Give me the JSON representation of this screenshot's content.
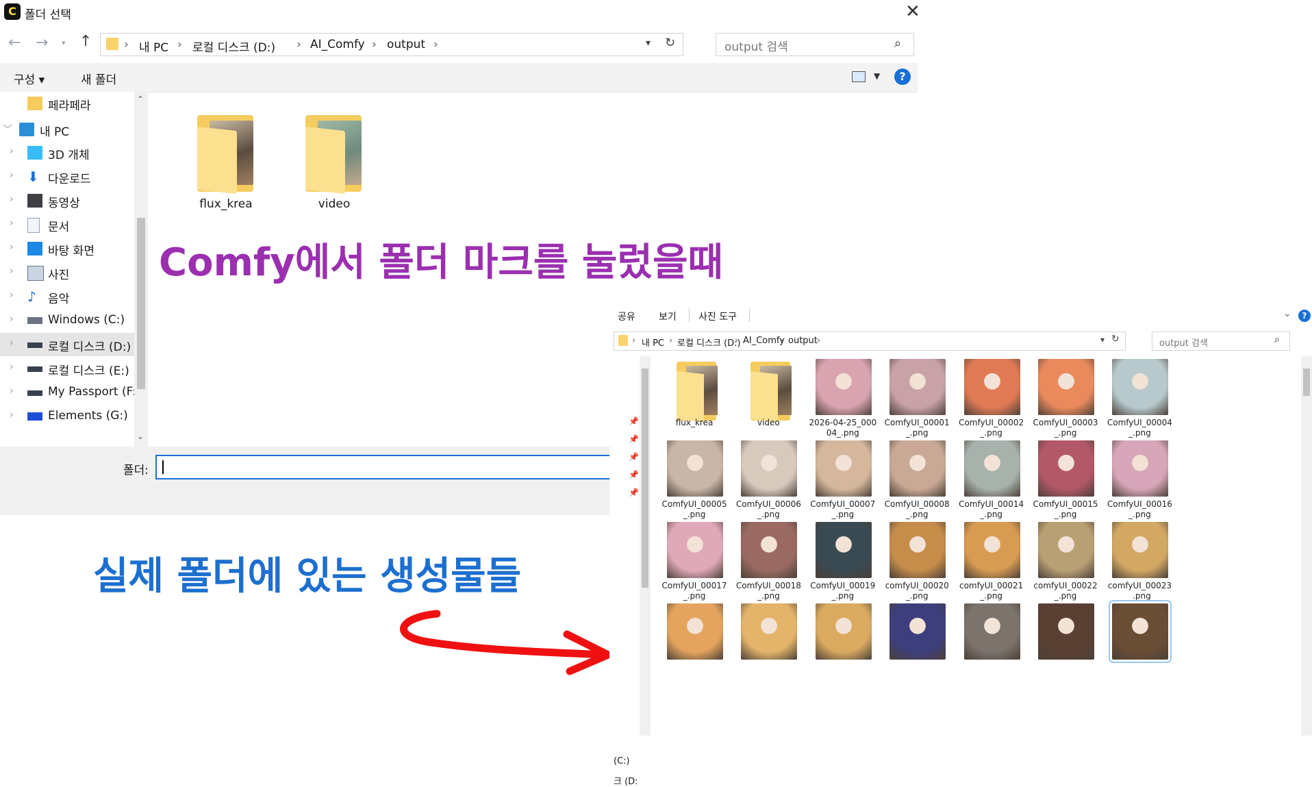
{
  "dialog": {
    "title": "폴더 선택",
    "app_icon_letter": "C",
    "address": {
      "crumbs": [
        "내 PC",
        "로컬 디스크 (D:)",
        "AI_Comfy",
        "output"
      ]
    },
    "search_placeholder": "output 검색",
    "toolbar": {
      "organize": "구성 ▾",
      "new_folder": "새 폴더",
      "help": "?"
    },
    "sidebar": [
      {
        "label": "페라페라",
        "icon": "folder-icon",
        "indent": 1
      },
      {
        "label": "내 PC",
        "icon": "pc-icon",
        "indent": 0
      },
      {
        "label": "3D 개체",
        "icon": "cube-icon",
        "indent": 1
      },
      {
        "label": "다운로드",
        "icon": "download-icon",
        "indent": 1
      },
      {
        "label": "동영상",
        "icon": "video-icon",
        "indent": 1
      },
      {
        "label": "문서",
        "icon": "document-icon",
        "indent": 1
      },
      {
        "label": "바탕 화면",
        "icon": "desktop-icon",
        "indent": 1
      },
      {
        "label": "사진",
        "icon": "picture-icon",
        "indent": 1
      },
      {
        "label": "음악",
        "icon": "music-icon",
        "indent": 1
      },
      {
        "label": "Windows (C:)",
        "icon": "drive-icon",
        "indent": 1
      },
      {
        "label": "로컬 디스크 (D:)",
        "icon": "drive-icon",
        "indent": 1
      },
      {
        "label": "로컬 디스크 (E:)",
        "icon": "drive-icon",
        "indent": 1
      },
      {
        "label": "My Passport (F:)",
        "icon": "drive-icon",
        "indent": 1
      },
      {
        "label": "Elements (G:)",
        "icon": "wd-drive-icon",
        "indent": 1
      }
    ],
    "folders": [
      "flux_krea",
      "video"
    ],
    "folder_field_label": "폴더:",
    "folder_field_value": ""
  },
  "annotations": {
    "top": "Comfy에서 폴더 마크를 눌렀을때",
    "bottom": "실제 폴더에 있는 생성물들",
    "top_color": "#9b2fb0",
    "bottom_color": "#1c6fcf",
    "arrow_color": "#ef1111"
  },
  "explorer": {
    "ribbon": [
      "공유",
      "보기",
      "사진 도구"
    ],
    "address": {
      "crumbs": [
        "내 PC",
        "로컬 디스크 (D:)",
        "AI_Comfy",
        "output"
      ]
    },
    "search_placeholder": "output 검색",
    "nav_drives": [
      "(C:)",
      "크 (D:"
    ],
    "items": [
      {
        "name": "flux_krea",
        "type": "folder"
      },
      {
        "name": "video",
        "type": "folder"
      },
      {
        "name": "2026-04-25_000\n04_.png",
        "color": "#d9a3b0"
      },
      {
        "name": "ComfyUI_00001\n_.png",
        "color": "#c9a2a8"
      },
      {
        "name": "ComfyUI_00002\n_.png",
        "color": "#e07a55"
      },
      {
        "name": "ComfyUI_00003\n_.png",
        "color": "#ea8a5c"
      },
      {
        "name": "ComfyUI_00004\n_.png",
        "color": "#b7c9cd"
      },
      {
        "name": "ComfyUI_00005\n_.png",
        "color": "#c8b6a8"
      },
      {
        "name": "ComfyUI_00006\n_.png",
        "color": "#d8c9bd"
      },
      {
        "name": "ComfyUI_00007\n_.png",
        "color": "#d4b79d"
      },
      {
        "name": "ComfyUI_00008\n_.png",
        "color": "#c9a995"
      },
      {
        "name": "ComfyUI_00014\n_.png",
        "color": "#a8b2ad"
      },
      {
        "name": "ComfyUI_00015\n_.png",
        "color": "#b35868"
      },
      {
        "name": "ComfyUI_00016\n_.png",
        "color": "#d7a6b8"
      },
      {
        "name": "ComfyUI_00017\n_.png",
        "color": "#e0a9b9"
      },
      {
        "name": "ComfyUI_00018\n_.png",
        "color": "#9a6a62"
      },
      {
        "name": "ComfyUI_00019\n_.png",
        "color": "#3a4a52"
      },
      {
        "name": "comfyUI_00020\n_.png",
        "color": "#c58c4a"
      },
      {
        "name": "comfyUI_00021\n_.png",
        "color": "#d89b52"
      },
      {
        "name": "comfyUI_00022\n_.png",
        "color": "#b9a074"
      },
      {
        "name": "comfyUI_00023\n_.png",
        "color": "#d2a863"
      },
      {
        "name": "",
        "color": "#e4a45e"
      },
      {
        "name": "",
        "color": "#e3b46a"
      },
      {
        "name": "",
        "color": "#d9aa60"
      },
      {
        "name": "",
        "color": "#3d3f7c"
      },
      {
        "name": "",
        "color": "#7b736c"
      },
      {
        "name": "",
        "color": "#5a4032"
      },
      {
        "name": "",
        "color": "#6a4d35"
      }
    ]
  }
}
